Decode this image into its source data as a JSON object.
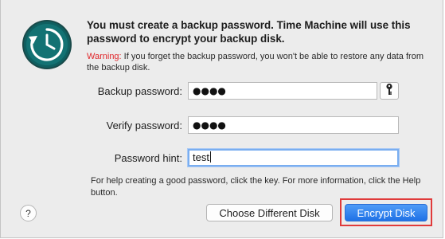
{
  "dialog": {
    "title": "You must create a backup password. Time Machine will use this password to encrypt your backup disk.",
    "warning_label": "Warning:",
    "warning_text": " If you forget the backup password, you won't be able to restore any data from the backup disk.",
    "app_icon": "time-machine-icon"
  },
  "form": {
    "backup_password_label": "Backup password:",
    "backup_password_value": "●●●●",
    "verify_password_label": "Verify password:",
    "verify_password_value": "●●●●",
    "hint_label": "Password hint:",
    "hint_value": "test",
    "key_icon": "key-icon"
  },
  "help": {
    "text": "For help creating a good password, click the key. For more information, click the Help button.",
    "button_label": "?"
  },
  "buttons": {
    "choose_disk": "Choose Different Disk",
    "encrypt_disk": "Encrypt Disk"
  },
  "colors": {
    "accent": "#1f72e6",
    "warning": "#e0262a",
    "highlight": "#e03a3a",
    "icon_teal": "#0f5f60"
  }
}
